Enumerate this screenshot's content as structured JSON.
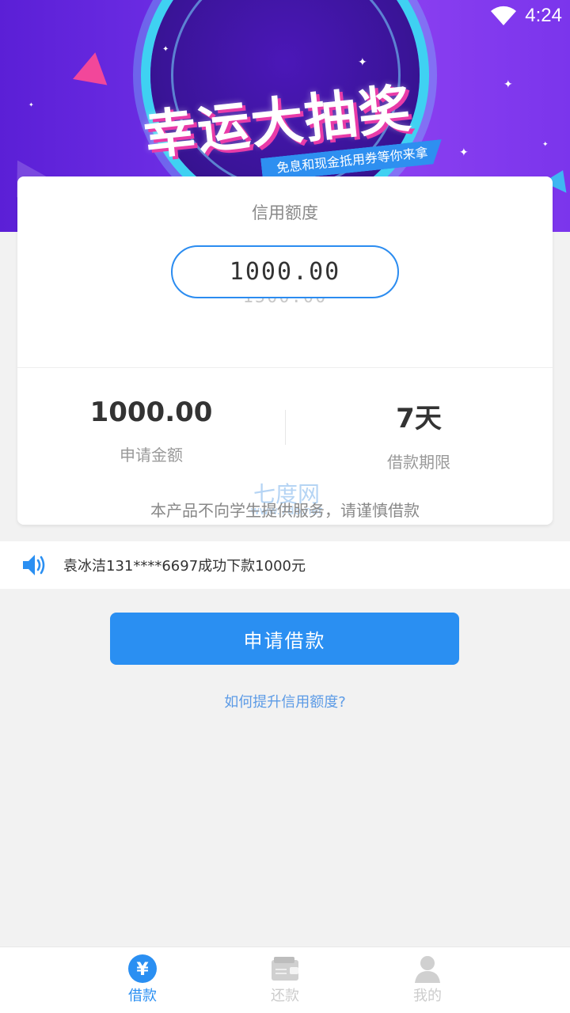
{
  "status_bar": {
    "time": "4:24"
  },
  "banner": {
    "title": "幸运大抽奖",
    "ribbon_text": "免息和现金抵用券等你来拿"
  },
  "credit_card": {
    "label": "信用额度",
    "selected_amount": "1000.00",
    "next_amount": "1500.00",
    "apply_amount_value": "1000.00",
    "apply_amount_label": "申请金额",
    "term_value": "7天",
    "term_label": "借款期限",
    "notice": "本产品不向学生提供服务，请谨慎借款",
    "watermark_text": "七度网",
    "watermark_url": "www.7do.net"
  },
  "marquee": {
    "icon": "speaker-icon",
    "message": "袁冰洁131****6697成功下款1000元"
  },
  "apply_button": {
    "label": "申请借款"
  },
  "help_link": {
    "label": "如何提升信用额度?"
  },
  "tabbar": {
    "tabs": [
      {
        "label": "借款",
        "icon": "yen-icon",
        "active": true
      },
      {
        "label": "还款",
        "icon": "wallet-icon",
        "active": false
      },
      {
        "label": "我的",
        "icon": "user-icon",
        "active": false
      }
    ]
  },
  "colors": {
    "accent": "#2a8ff2",
    "banner_purple": "#6f2fe6",
    "banner_pink": "#e93ba8",
    "background": "#f2f2f2"
  }
}
